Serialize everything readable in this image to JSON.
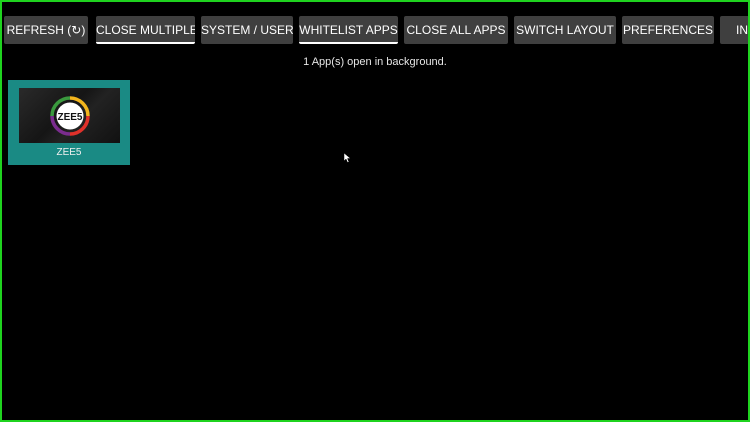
{
  "toolbar": {
    "buttons": [
      {
        "label": "REFRESH (↻)"
      },
      {
        "label": "CLOSE MULTIPLE"
      },
      {
        "label": "SYSTEM / USER"
      },
      {
        "label": "WHITELIST APPS"
      },
      {
        "label": "CLOSE ALL APPS"
      },
      {
        "label": "SWITCH LAYOUT"
      },
      {
        "label": "PREFERENCES"
      },
      {
        "label": "INT"
      }
    ]
  },
  "status": {
    "text": "1 App(s) open in background."
  },
  "apps": [
    {
      "name": "ZEE5",
      "logo_text": "ZEE5",
      "icon": "zee5-logo-icon"
    }
  ],
  "colors": {
    "frame_border": "#1fd31f",
    "button_bg": "#3f3f3f",
    "tile_bg": "#1a8a84"
  }
}
